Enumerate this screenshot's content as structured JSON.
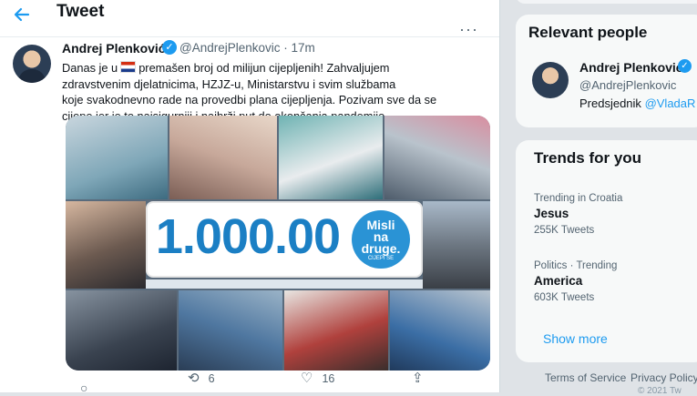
{
  "header": {
    "title": "Tweet",
    "back_icon": "arrow-left-icon"
  },
  "tweet": {
    "author_name": "Andrej Plenković",
    "handle_time": "@AndrejPlenkovic · 17m",
    "more_label": "···",
    "text_lines": [
      "Danas je u",
      "premašen broj od milijun cijepljenih! Zahvaljujem",
      "zdravstvenim djelatnicima, HZJZ-u, Ministarstvu i svim službama",
      "koje svakodnevno rade na provedbi plana cijepljenja. Pozivam sve da se",
      "cijepe jer je to najsigurniji i najbrži put do okončanja pandemije."
    ],
    "media": {
      "banner_number": "1.000.00",
      "badge_line1": "Misli",
      "badge_line2": "na",
      "badge_line3": "druge.",
      "badge_small": "CIJEPI SE"
    },
    "actions": {
      "retweets": "6",
      "likes": "16"
    }
  },
  "sidebar": {
    "relevant_people": {
      "title": "Relevant people",
      "name": "Andrej Plenković",
      "handle": "@AndrejPlenkovic",
      "bio_prefix": "Predsjednik",
      "bio_link": "@VladaR"
    },
    "trends": {
      "title": "Trends for you",
      "items": [
        {
          "context": "Trending in Croatia",
          "topic": "Jesus",
          "count": "255K Tweets"
        },
        {
          "context": "Politics · Trending",
          "topic": "America",
          "count": "603K Tweets"
        }
      ],
      "show_more": "Show more"
    },
    "footer": {
      "terms": "Terms of Service",
      "privacy": "Privacy Policy",
      "copyright": "© 2021 Tw"
    }
  },
  "colors": {
    "accent": "#1d9bf0",
    "banner_blue": "#1b7fc4",
    "flag_red": "#d42e12",
    "flag_blue": "#1b3c8c"
  }
}
